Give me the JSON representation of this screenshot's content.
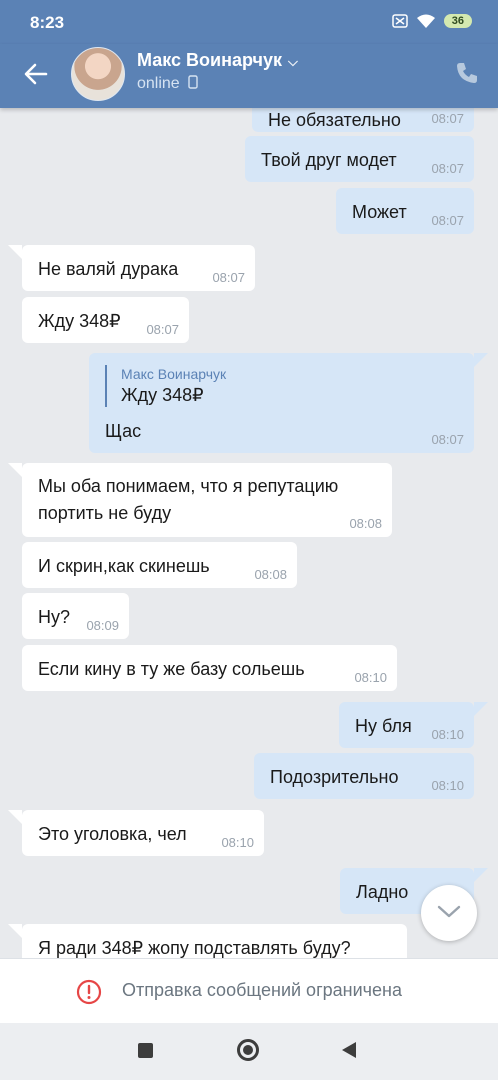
{
  "status_bar": {
    "time": "8:23",
    "battery": "36"
  },
  "header": {
    "contact_name": "Макс Воинарчук",
    "status": "online"
  },
  "messages": [
    {
      "text": "Не обязательно",
      "time": "08:07"
    },
    {
      "text": "Твой друг модет",
      "time": "08:07"
    },
    {
      "text": "Может",
      "time": "08:07"
    },
    {
      "text": "Не валяй дурака",
      "time": "08:07"
    },
    {
      "text": "Жду 348₽",
      "time": "08:07"
    },
    {
      "reply_name": "Макс Воинарчук",
      "reply_text": "Жду 348₽",
      "text": "Щас",
      "time": "08:07"
    },
    {
      "line1": "Мы оба понимаем, что я репутацию",
      "line2": "портить не буду",
      "time": "08:08"
    },
    {
      "text": "И скрин,как скинешь",
      "time": "08:08"
    },
    {
      "text": "Ну?",
      "time": "08:09"
    },
    {
      "text": "Если кину в ту же базу сольешь",
      "time": "08:10"
    },
    {
      "text": "Ну бля",
      "time": "08:10"
    },
    {
      "text": "Подозрительно",
      "time": "08:10"
    },
    {
      "text": "Это уголовка, чел",
      "time": "08:10"
    },
    {
      "text": "Ладно",
      "time": ""
    },
    {
      "text": "Я ради 348₽ жопу подставлять буду?",
      "time": ""
    }
  ],
  "composer": {
    "restricted_text": "Отправка сообщений ограничена"
  }
}
